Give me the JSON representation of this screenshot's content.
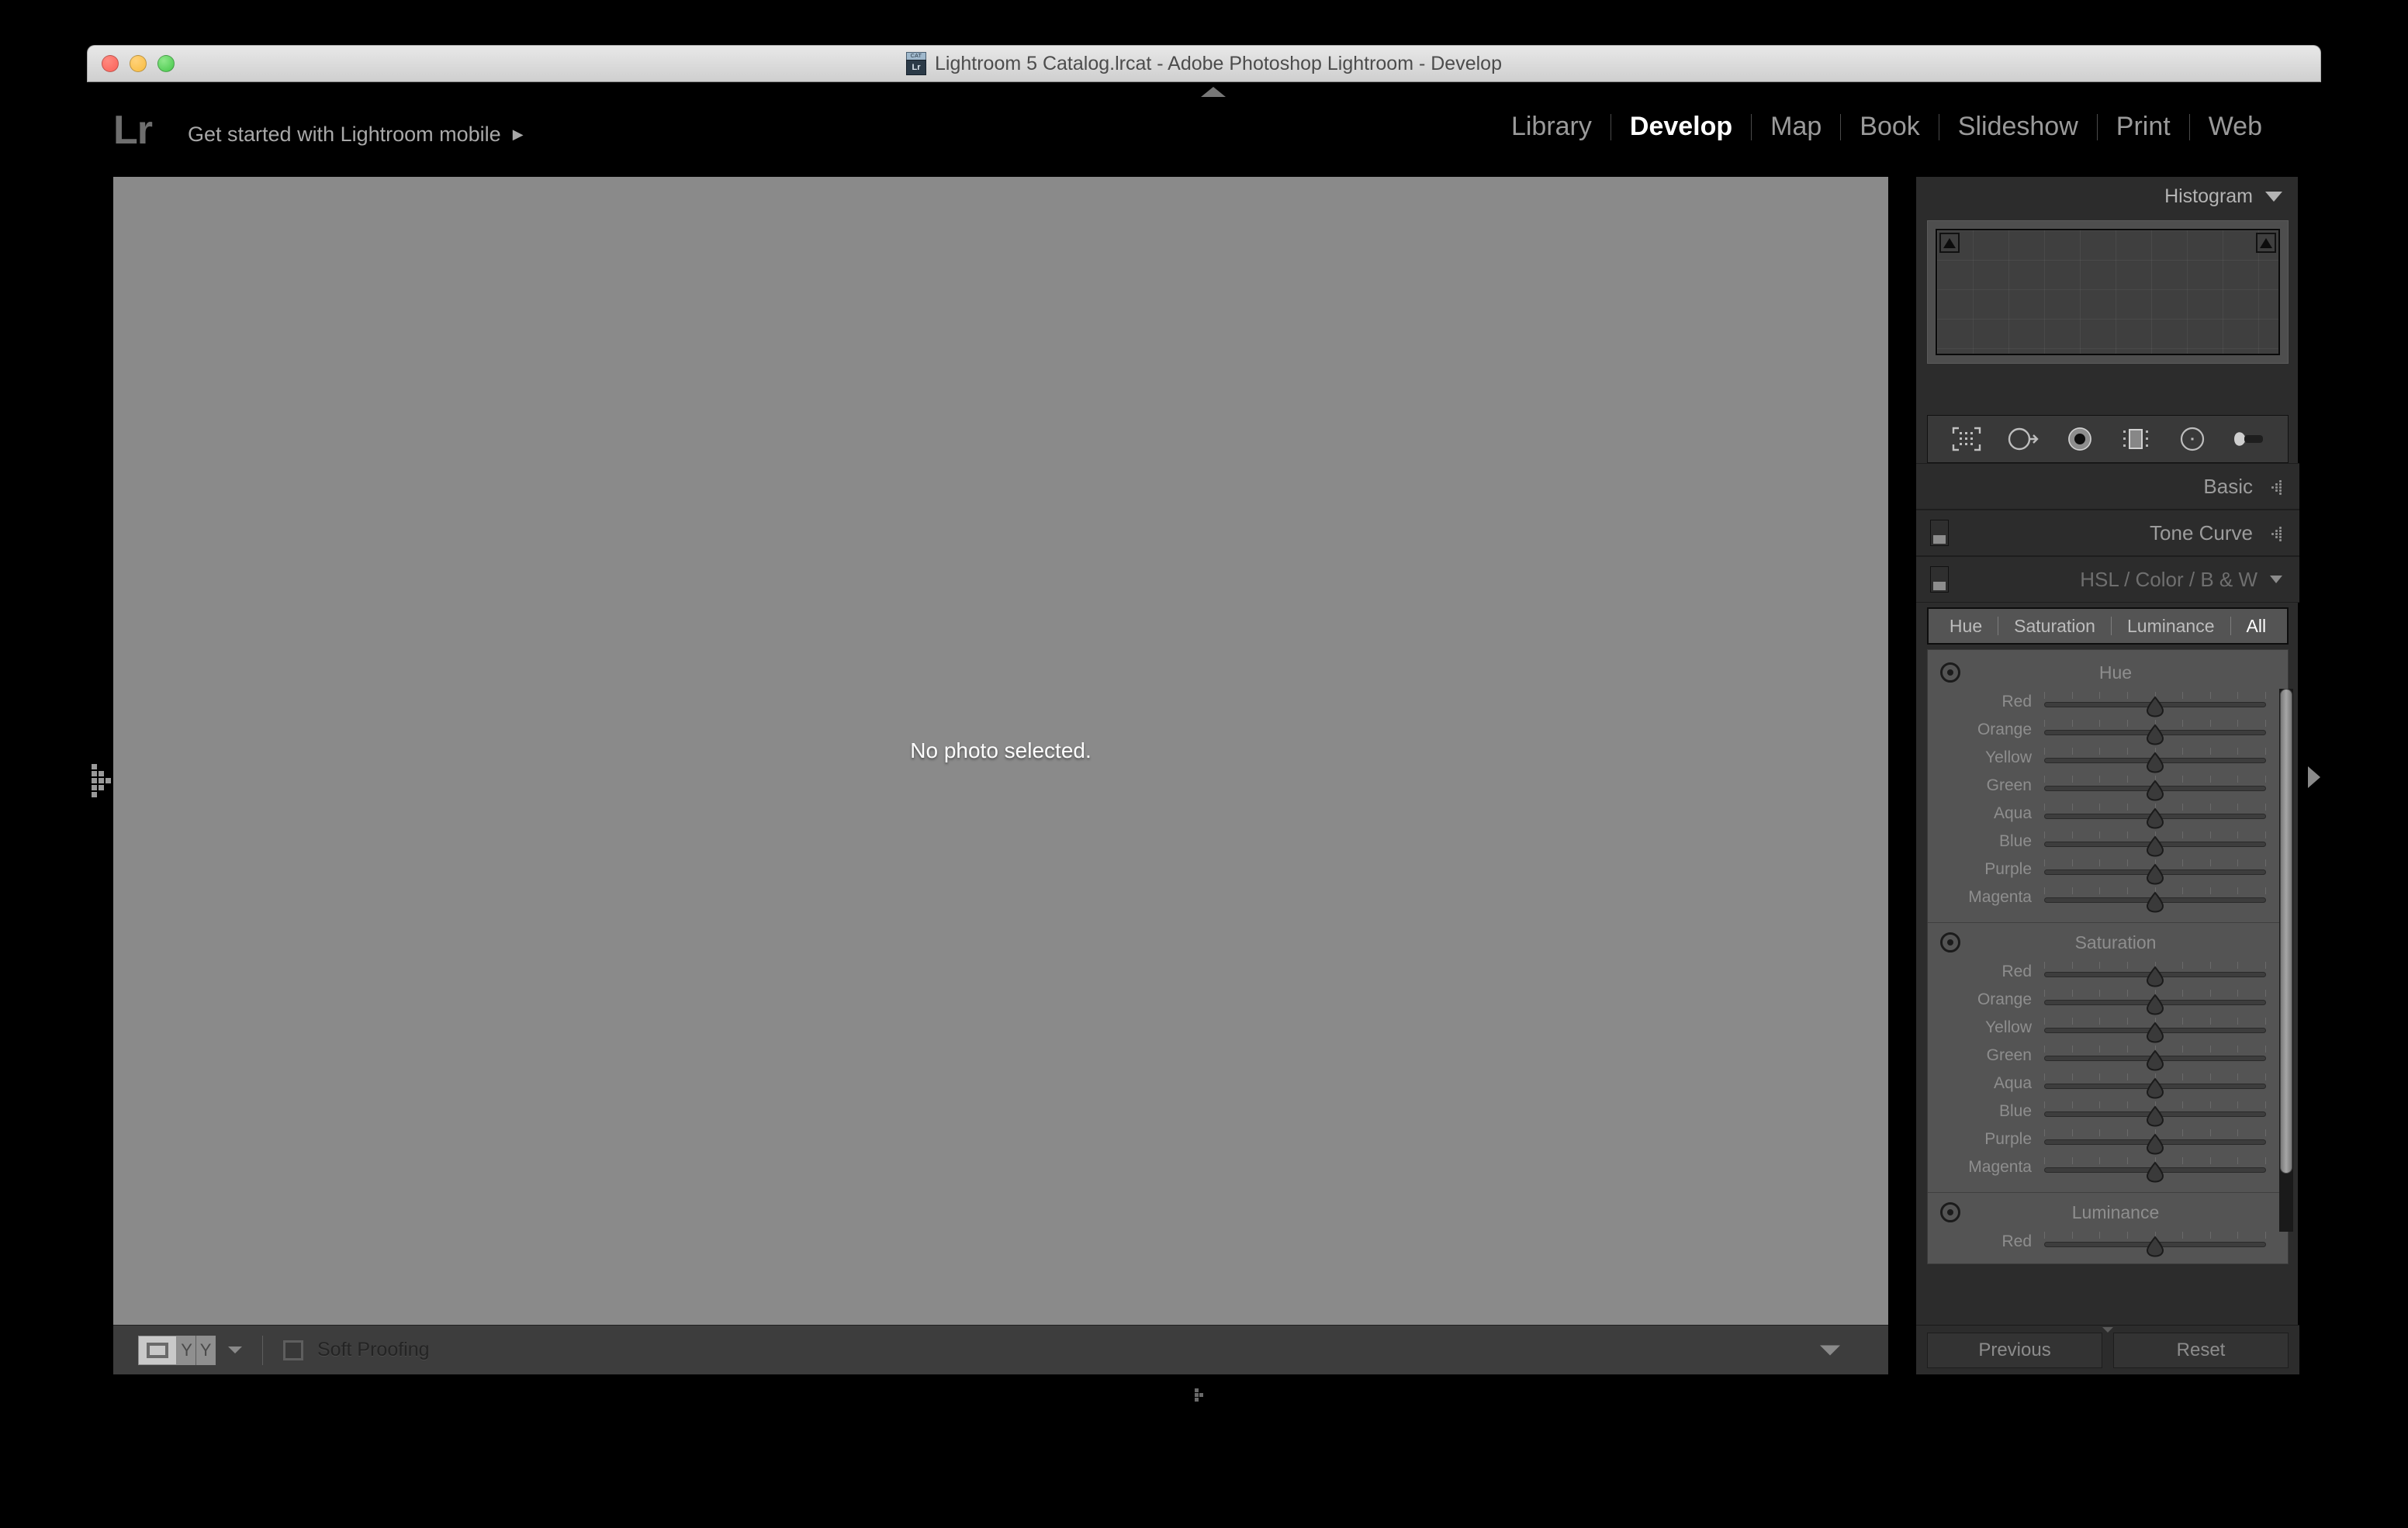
{
  "window": {
    "title": "Lightroom 5 Catalog.lrcat - Adobe Photoshop Lightroom - Develop",
    "catalog_icon_top": "CAT",
    "catalog_icon_bottom": "Lr",
    "traffic_lights": [
      "close",
      "minimize",
      "zoom"
    ]
  },
  "topbar": {
    "logo": "Lr",
    "promo_label": "Get started with Lightroom mobile",
    "promo_arrow": "▶",
    "modules": [
      {
        "label": "Library",
        "active": false
      },
      {
        "label": "Develop",
        "active": true
      },
      {
        "label": "Map",
        "active": false
      },
      {
        "label": "Book",
        "active": false
      },
      {
        "label": "Slideshow",
        "active": false
      },
      {
        "label": "Print",
        "active": false
      },
      {
        "label": "Web",
        "active": false
      }
    ]
  },
  "canvas": {
    "message": "No photo selected."
  },
  "toolbar": {
    "view_loupe_icon": "loupe-view-icon",
    "view_beforeafter_left": "Y",
    "view_beforeafter_right": "Y",
    "soft_proofing_label": "Soft Proofing",
    "soft_proofing_checked": false
  },
  "right_panel": {
    "histogram": {
      "title": "Histogram",
      "shadow_clipping_label": "shadow-clipping",
      "highlight_clipping_label": "highlight-clipping"
    },
    "tools": [
      {
        "name": "crop-overlay-icon"
      },
      {
        "name": "spot-removal-icon"
      },
      {
        "name": "red-eye-correction-icon"
      },
      {
        "name": "graduated-filter-icon"
      },
      {
        "name": "radial-filter-icon"
      },
      {
        "name": "adjustment-brush-icon"
      }
    ],
    "panels": [
      {
        "title": "Basic",
        "expanded": false,
        "has_switch": false
      },
      {
        "title": "Tone Curve",
        "expanded": false,
        "has_switch": true
      }
    ],
    "hsl": {
      "title_parts": [
        "HSL",
        "/",
        "Color",
        "/",
        "B & W"
      ],
      "expanded": true,
      "has_switch": true,
      "tabs": [
        {
          "label": "Hue",
          "active": false
        },
        {
          "label": "Saturation",
          "active": false
        },
        {
          "label": "Luminance",
          "active": false
        },
        {
          "label": "All",
          "active": true
        }
      ],
      "sections": [
        {
          "title": "Hue",
          "sliders": [
            {
              "label": "Red",
              "value": 0
            },
            {
              "label": "Orange",
              "value": 0
            },
            {
              "label": "Yellow",
              "value": 0
            },
            {
              "label": "Green",
              "value": 0
            },
            {
              "label": "Aqua",
              "value": 0
            },
            {
              "label": "Blue",
              "value": 0
            },
            {
              "label": "Purple",
              "value": 0
            },
            {
              "label": "Magenta",
              "value": 0
            }
          ]
        },
        {
          "title": "Saturation",
          "sliders": [
            {
              "label": "Red",
              "value": 0
            },
            {
              "label": "Orange",
              "value": 0
            },
            {
              "label": "Yellow",
              "value": 0
            },
            {
              "label": "Green",
              "value": 0
            },
            {
              "label": "Aqua",
              "value": 0
            },
            {
              "label": "Blue",
              "value": 0
            },
            {
              "label": "Purple",
              "value": 0
            },
            {
              "label": "Magenta",
              "value": 0
            }
          ]
        },
        {
          "title": "Luminance",
          "sliders": [
            {
              "label": "Red",
              "value": 0
            }
          ]
        }
      ]
    },
    "buttons": {
      "previous": "Previous",
      "reset": "Reset"
    }
  },
  "colors": {
    "panel_bg": "#2c2c2c",
    "canvas_bg": "#8a8a8a",
    "sub_panel_bg": "#545454",
    "text_dim": "#8e8e8e",
    "text_bright": "#ffffff",
    "accent_active": "#ffffff"
  }
}
